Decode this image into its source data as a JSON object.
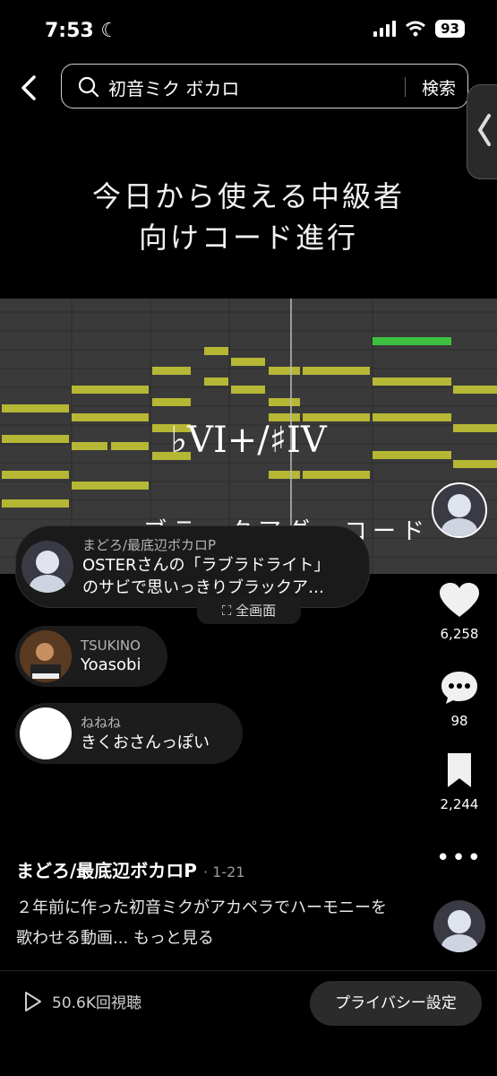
{
  "status": {
    "time": "7:53",
    "battery": "93"
  },
  "search": {
    "query": "初音ミク ボカロ",
    "button": "検索"
  },
  "video": {
    "title": "今日から使える中級者\n向けコード進行",
    "chord": "♭VI+/♯IV",
    "caption_partial": "ブラックアダーコード",
    "fullscreen_label": "全画面"
  },
  "comments": [
    {
      "name": "まどろ/最底辺ボカロP",
      "text": "OSTERさんの「ラブラドライト」\nのサビで思いっきりブラックア…"
    },
    {
      "name": "TSUKINO",
      "text": "Yoasobi"
    },
    {
      "name": "ねねね",
      "text": "きくおさんっぽい"
    }
  ],
  "rail": {
    "likes": "6,258",
    "comments": "98",
    "saves": "2,244"
  },
  "post": {
    "author": "まどろ/最底辺ボカロP",
    "date": "· 1-21",
    "description": "２年前に作った初音ミクがアカペラでハーモニーを歌わせる動画... もっと見る"
  },
  "footer": {
    "views": "50.6K回視聴",
    "privacy": "プライバシー設定"
  }
}
